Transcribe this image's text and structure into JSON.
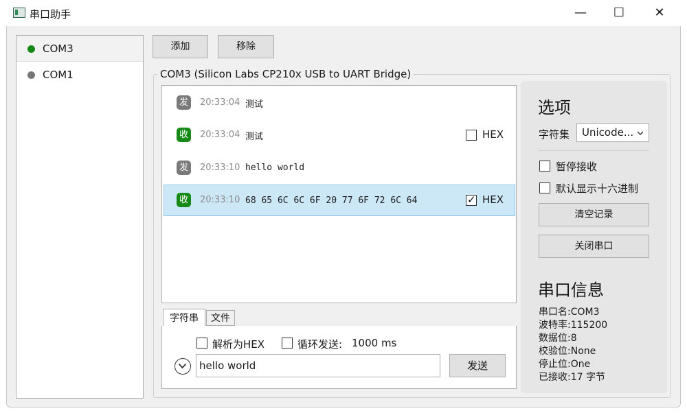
{
  "window": {
    "title": "串口助手",
    "app_icon": "serial-port-app-icon",
    "controls": [
      "—",
      "☐",
      "✕"
    ]
  },
  "sidebar": {
    "items": [
      {
        "label": "COM3",
        "status": "connected",
        "color": "#168a16"
      },
      {
        "label": "COM1",
        "status": "disconnected",
        "color": "#777777"
      }
    ]
  },
  "toolbar": {
    "add_label": "添加",
    "remove_label": "移除"
  },
  "port_group": {
    "title": "COM3 (Silicon Labs CP210x USB to UART Bridge)"
  },
  "messages": [
    {
      "badge": "发",
      "dir": "send",
      "time": "20:33:04",
      "text": "测试"
    },
    {
      "badge": "收",
      "dir": "recv",
      "time": "20:33:04",
      "text": "测试",
      "hex_label": "HEX",
      "hex_checked": false
    },
    {
      "badge": "发",
      "dir": "send",
      "time": "20:33:10",
      "text": "hello world"
    },
    {
      "badge": "收",
      "dir": "recv",
      "time": "20:33:10",
      "text": "68 65 6C 6C 6F 20 77 6F 72 6C 64",
      "hex_label": "HEX",
      "hex_checked": true,
      "selected": true
    }
  ],
  "send_tabs": [
    "字符串",
    "文件"
  ],
  "send": {
    "parse_hex_label": "解析为HEX",
    "loop_label": "循环发送:",
    "loop_interval": "1000 ms",
    "input_value": "hello world",
    "send_label": "发送"
  },
  "options": {
    "title": "选项",
    "charset_label": "字符集",
    "charset_value": "Unicode...",
    "pause_label": "暂停接收",
    "default_hex_label": "默认显示十六进制",
    "clear_label": "清空记录",
    "close_label": "关闭串口"
  },
  "port_info": {
    "title": "串口信息",
    "lines": [
      "串口名:COM3",
      "波特率:115200",
      "数据位:8",
      "校验位:None",
      "停止位:One",
      "已接收:17 字节"
    ]
  },
  "colors": {
    "accent_send": "#7a7a7a",
    "accent_recv": "#168a16",
    "selection": "#cce8f7"
  }
}
